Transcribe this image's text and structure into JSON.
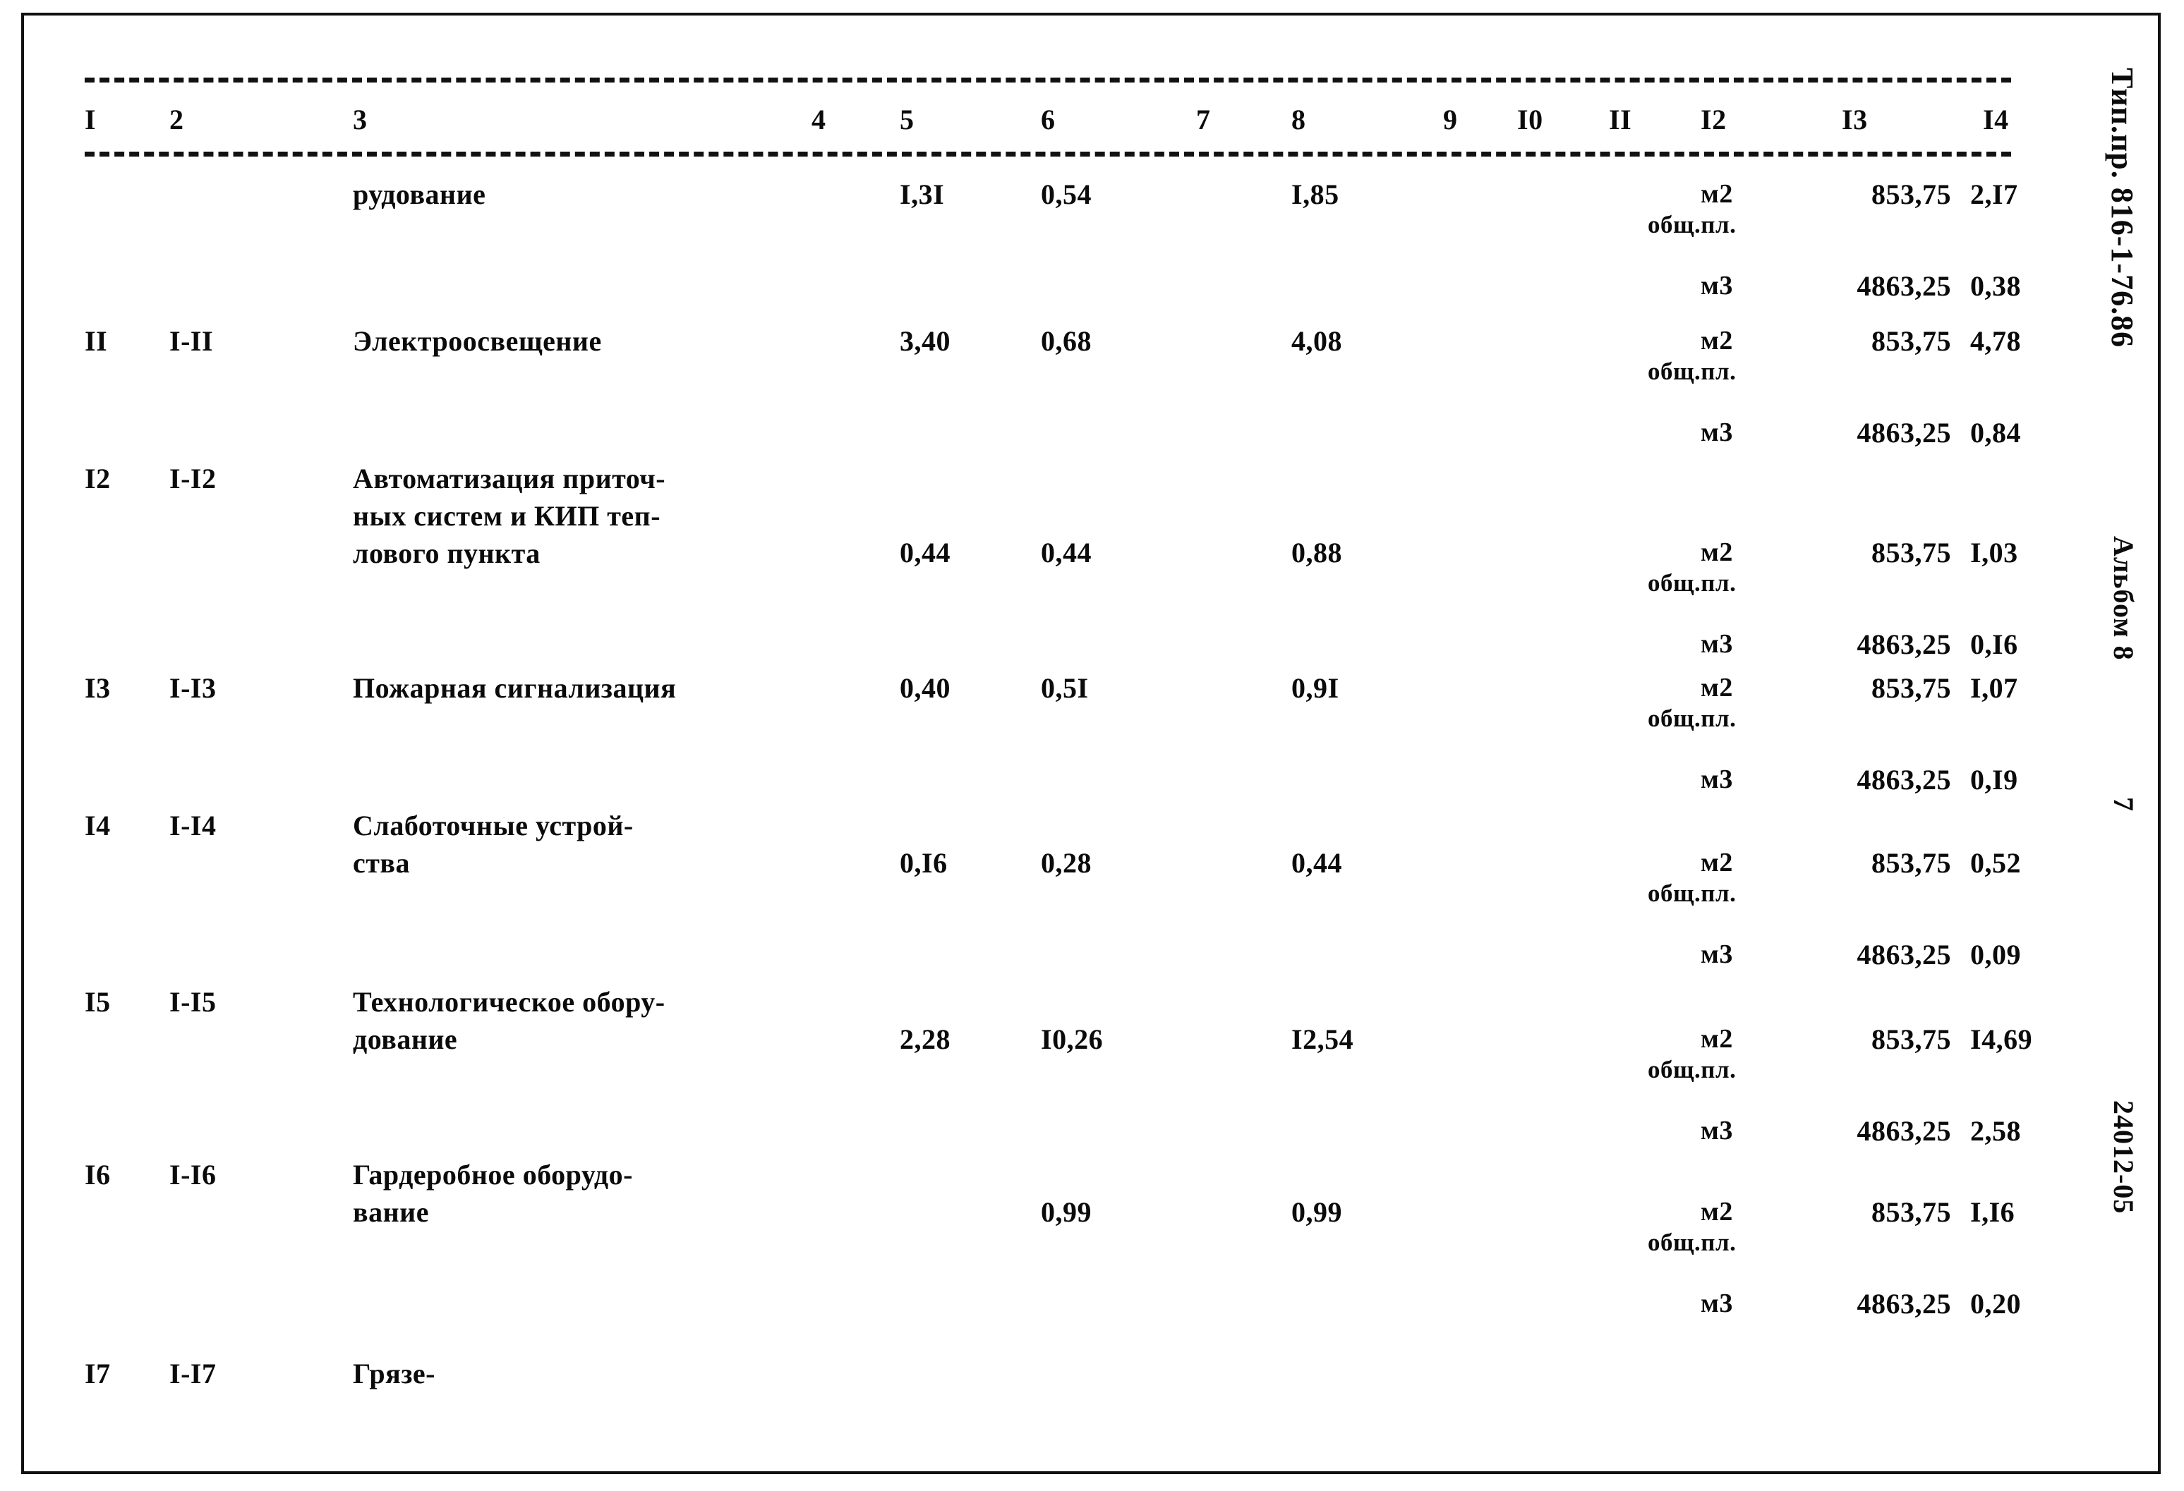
{
  "document": {
    "type": "scanned-technical-table",
    "language": "ru"
  },
  "table": {
    "column_headers": [
      "I",
      "2",
      "3",
      "4",
      "5",
      "6",
      "7",
      "8",
      "9",
      "I0",
      "II",
      "I2",
      "I3",
      "I4"
    ],
    "rows": [
      {
        "num": "",
        "code": "",
        "description": "рудование",
        "c4": "",
        "c5": "I,3I",
        "c6": "0,54",
        "c7": "",
        "c8": "I,85",
        "c9": "",
        "c10": "",
        "c11": "",
        "units": [
          {
            "unit": "м2",
            "unit_note": "общ.пл.",
            "amount": "853,75",
            "value": "2,I7"
          },
          {
            "unit": "м3",
            "unit_note": "",
            "amount": "4863,25",
            "value": "0,38"
          }
        ]
      },
      {
        "num": "II",
        "code": "I-II",
        "description": "Электроосвещение",
        "c4": "",
        "c5": "3,40",
        "c6": "0,68",
        "c7": "",
        "c8": "4,08",
        "c9": "",
        "c10": "",
        "c11": "",
        "units": [
          {
            "unit": "м2",
            "unit_note": "общ.пл.",
            "amount": "853,75",
            "value": "4,78"
          },
          {
            "unit": "м3",
            "unit_note": "",
            "amount": "4863,25",
            "value": "0,84"
          }
        ]
      },
      {
        "num": "I2",
        "code": "I-I2",
        "description": "Автоматизация приточ-\nных систем и КИП теп-\nлового пункта",
        "c4": "",
        "c5": "0,44",
        "c6": "0,44",
        "c7": "",
        "c8": "0,88",
        "c9": "",
        "c10": "",
        "c11": "",
        "units": [
          {
            "unit": "м2",
            "unit_note": "общ.пл.",
            "amount": "853,75",
            "value": "I,03"
          },
          {
            "unit": "м3",
            "unit_note": "",
            "amount": "4863,25",
            "value": "0,I6"
          }
        ]
      },
      {
        "num": "I3",
        "code": "I-I3",
        "description": "Пожарная сигнализация",
        "c4": "",
        "c5": "0,40",
        "c6": "0,5I",
        "c7": "",
        "c8": "0,9I",
        "c9": "",
        "c10": "",
        "c11": "",
        "units": [
          {
            "unit": "м2",
            "unit_note": "общ.пл.",
            "amount": "853,75",
            "value": "I,07"
          },
          {
            "unit": "м3",
            "unit_note": "",
            "amount": "4863,25",
            "value": "0,I9"
          }
        ]
      },
      {
        "num": "I4",
        "code": "I-I4",
        "description": "Слаботочные устрой-\nства",
        "c4": "",
        "c5": "0,I6",
        "c6": "0,28",
        "c7": "",
        "c8": "0,44",
        "c9": "",
        "c10": "",
        "c11": "",
        "units": [
          {
            "unit": "м2",
            "unit_note": "общ.пл.",
            "amount": "853,75",
            "value": "0,52"
          },
          {
            "unit": "м3",
            "unit_note": "",
            "amount": "4863,25",
            "value": "0,09"
          }
        ]
      },
      {
        "num": "I5",
        "code": "I-I5",
        "description": "Технологическое обору-\nдование",
        "c4": "",
        "c5": "2,28",
        "c6": "I0,26",
        "c7": "",
        "c8": "I2,54",
        "c9": "",
        "c10": "",
        "c11": "",
        "units": [
          {
            "unit": "м2",
            "unit_note": "общ.пл.",
            "amount": "853,75",
            "value": "I4,69"
          },
          {
            "unit": "м3",
            "unit_note": "",
            "amount": "4863,25",
            "value": "2,58"
          }
        ]
      },
      {
        "num": "I6",
        "code": "I-I6",
        "description": "Гардеробное оборудо-\nвание",
        "c4": "",
        "c5": "",
        "c6": "0,99",
        "c7": "",
        "c8": "0,99",
        "c9": "",
        "c10": "",
        "c11": "",
        "units": [
          {
            "unit": "м2",
            "unit_note": "общ.пл.",
            "amount": "853,75",
            "value": "I,I6"
          },
          {
            "unit": "м3",
            "unit_note": "",
            "amount": "4863,25",
            "value": "0,20"
          }
        ]
      },
      {
        "num": "I7",
        "code": "I-I7",
        "description": "Грязе-",
        "c4": "",
        "c5": "",
        "c6": "",
        "c7": "",
        "c8": "",
        "c9": "",
        "c10": "",
        "c11": "",
        "units": []
      }
    ]
  },
  "margin": {
    "code": "Тип.пр. 816-1-76.86",
    "album": "Альбом 8",
    "page_number": "7",
    "doc_number": "24012-05"
  }
}
